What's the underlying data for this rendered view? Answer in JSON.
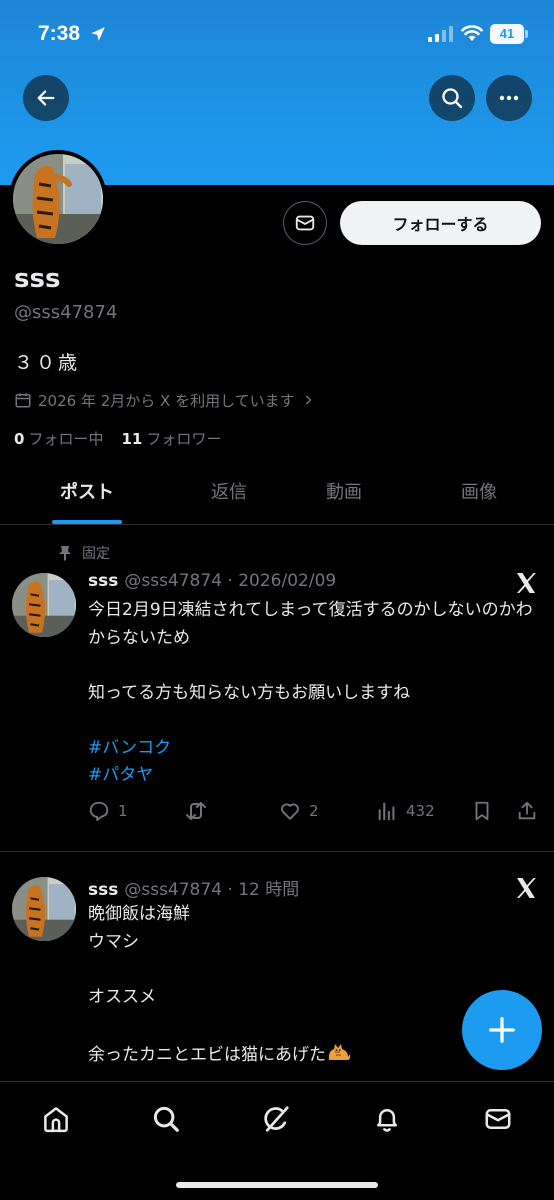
{
  "status_bar": {
    "time": "7:38",
    "battery": "41"
  },
  "profile": {
    "display_name": "sss",
    "handle": "@sss47874",
    "bio": "３０歳",
    "joined": "2026 年 2月から X を利用しています",
    "following_count": "0",
    "following_label": "フォロー中",
    "followers_count": "11",
    "followers_label": "フォロワー",
    "follow_button": "フォローする"
  },
  "tabs": [
    {
      "label": "ポスト",
      "active": true
    },
    {
      "label": "返信",
      "active": false
    },
    {
      "label": "動画",
      "active": false
    },
    {
      "label": "画像",
      "active": false
    }
  ],
  "posts": [
    {
      "pinned_label": "固定",
      "name": "sss",
      "handle_time": "@sss47874 · 2026/02/09",
      "text": "今日2月9日凍結されてしまって復活するのかしないのかわからないため\n\n知ってる方も知らない方もお願いしますね",
      "hashtags": [
        "#バンコク",
        "#パタヤ"
      ],
      "replies": "1",
      "reposts": "",
      "likes": "2",
      "views": "432"
    },
    {
      "name": "sss",
      "handle_time": "@sss47874 · 12 時間",
      "text": "晩御飯は海鮮\nウマシ\n\nオススメ\n\n余ったカニとエビは猫にあげた"
    }
  ],
  "icons": {
    "back": "arrow-left-icon",
    "search": "search-icon",
    "more": "more-horizontal-icon",
    "dm": "envelope-icon",
    "x_logo": "x-logo-icon",
    "compose": "plus-icon",
    "nav": [
      "home-icon",
      "search-icon",
      "grok-icon",
      "bell-icon",
      "envelope-icon"
    ]
  },
  "colors": {
    "accent": "#1d9bf0",
    "background": "#000000",
    "text": "#e7e9ea",
    "muted": "#71767b"
  }
}
